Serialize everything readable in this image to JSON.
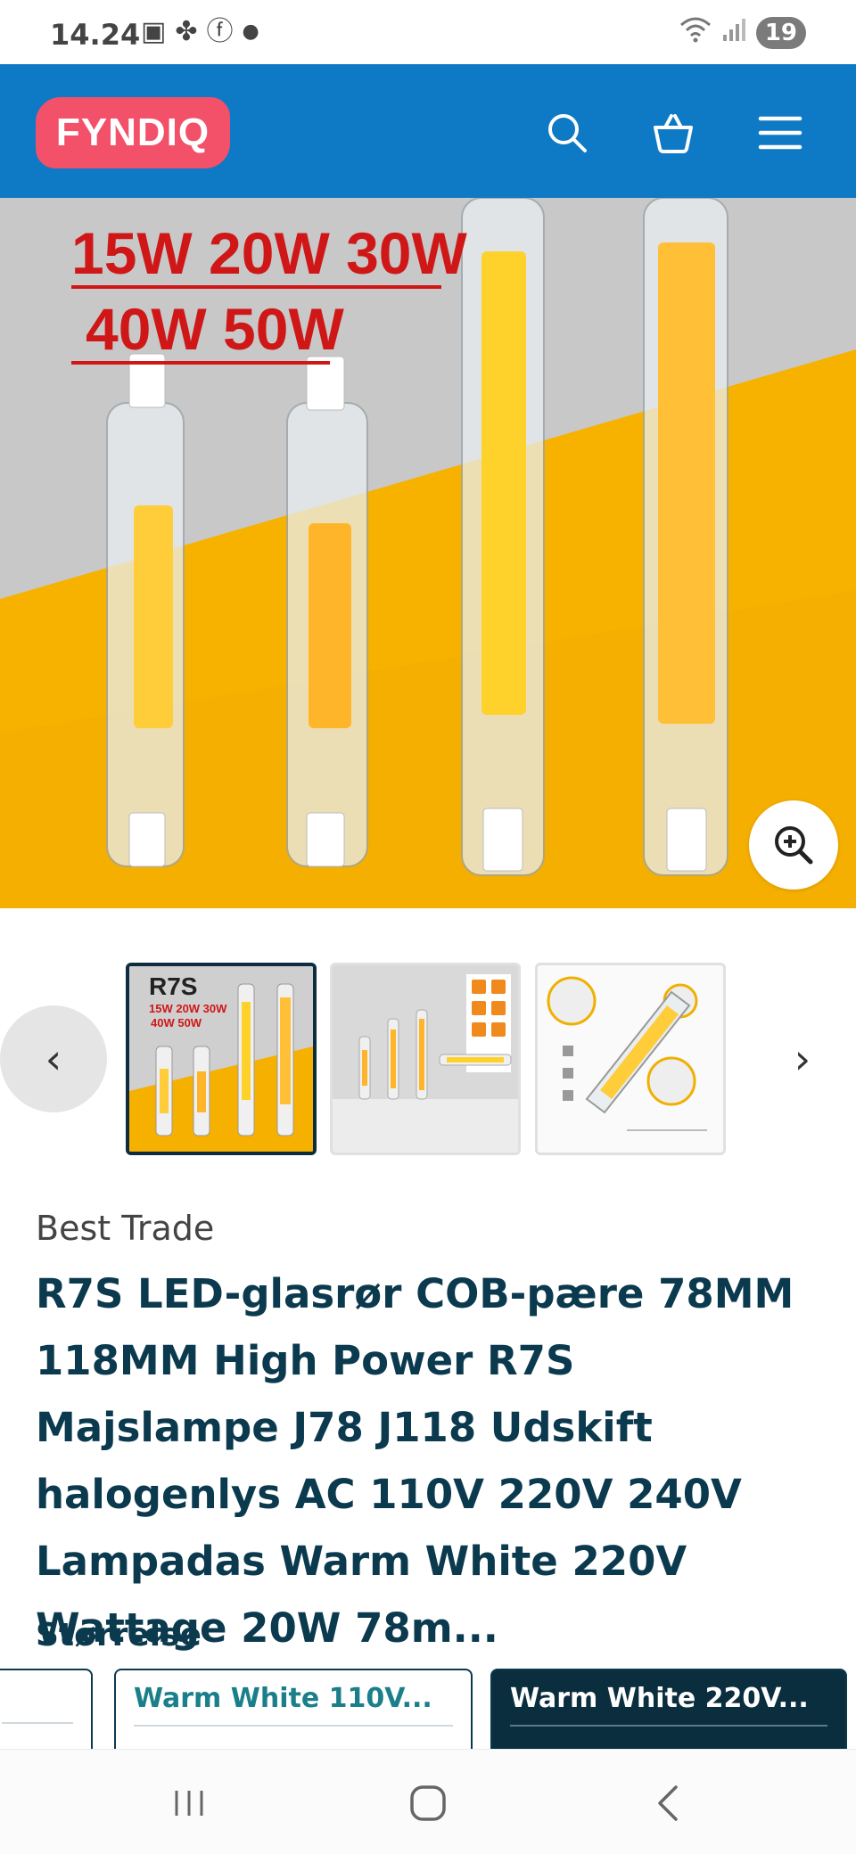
{
  "status_bar": {
    "time": "14.24",
    "notification_icons": [
      "screenshot-icon",
      "fan-icon",
      "facebook-icon",
      "dot-icon"
    ],
    "battery": "19"
  },
  "header": {
    "logo_text": "FYNDIQ",
    "brand_color": "#0e79c5",
    "logo_color": "#f3506a"
  },
  "hero": {
    "line1": "15W 20W 30W",
    "line2": "40W 50W"
  },
  "thumbnails": {
    "first": {
      "title": "R7S",
      "line1": "15W 20W 30W",
      "line2": "40W 50W"
    },
    "prev_label": "‹",
    "next_label": "›"
  },
  "product": {
    "seller": "Best Trade",
    "title": "R7S LED-glasrør COB-pære 78MM 118MM High Power R7S Majslampe J78 J118 Udskift halogenlys AC 110V 220V 240V Lampadas Warm White 220V Wattage 20W 78m..."
  },
  "size": {
    "label": "Størrelse",
    "options": [
      {
        "label": "Warm White 110V...",
        "selected": false
      },
      {
        "label": "Warm White 220V...",
        "selected": true
      }
    ]
  }
}
